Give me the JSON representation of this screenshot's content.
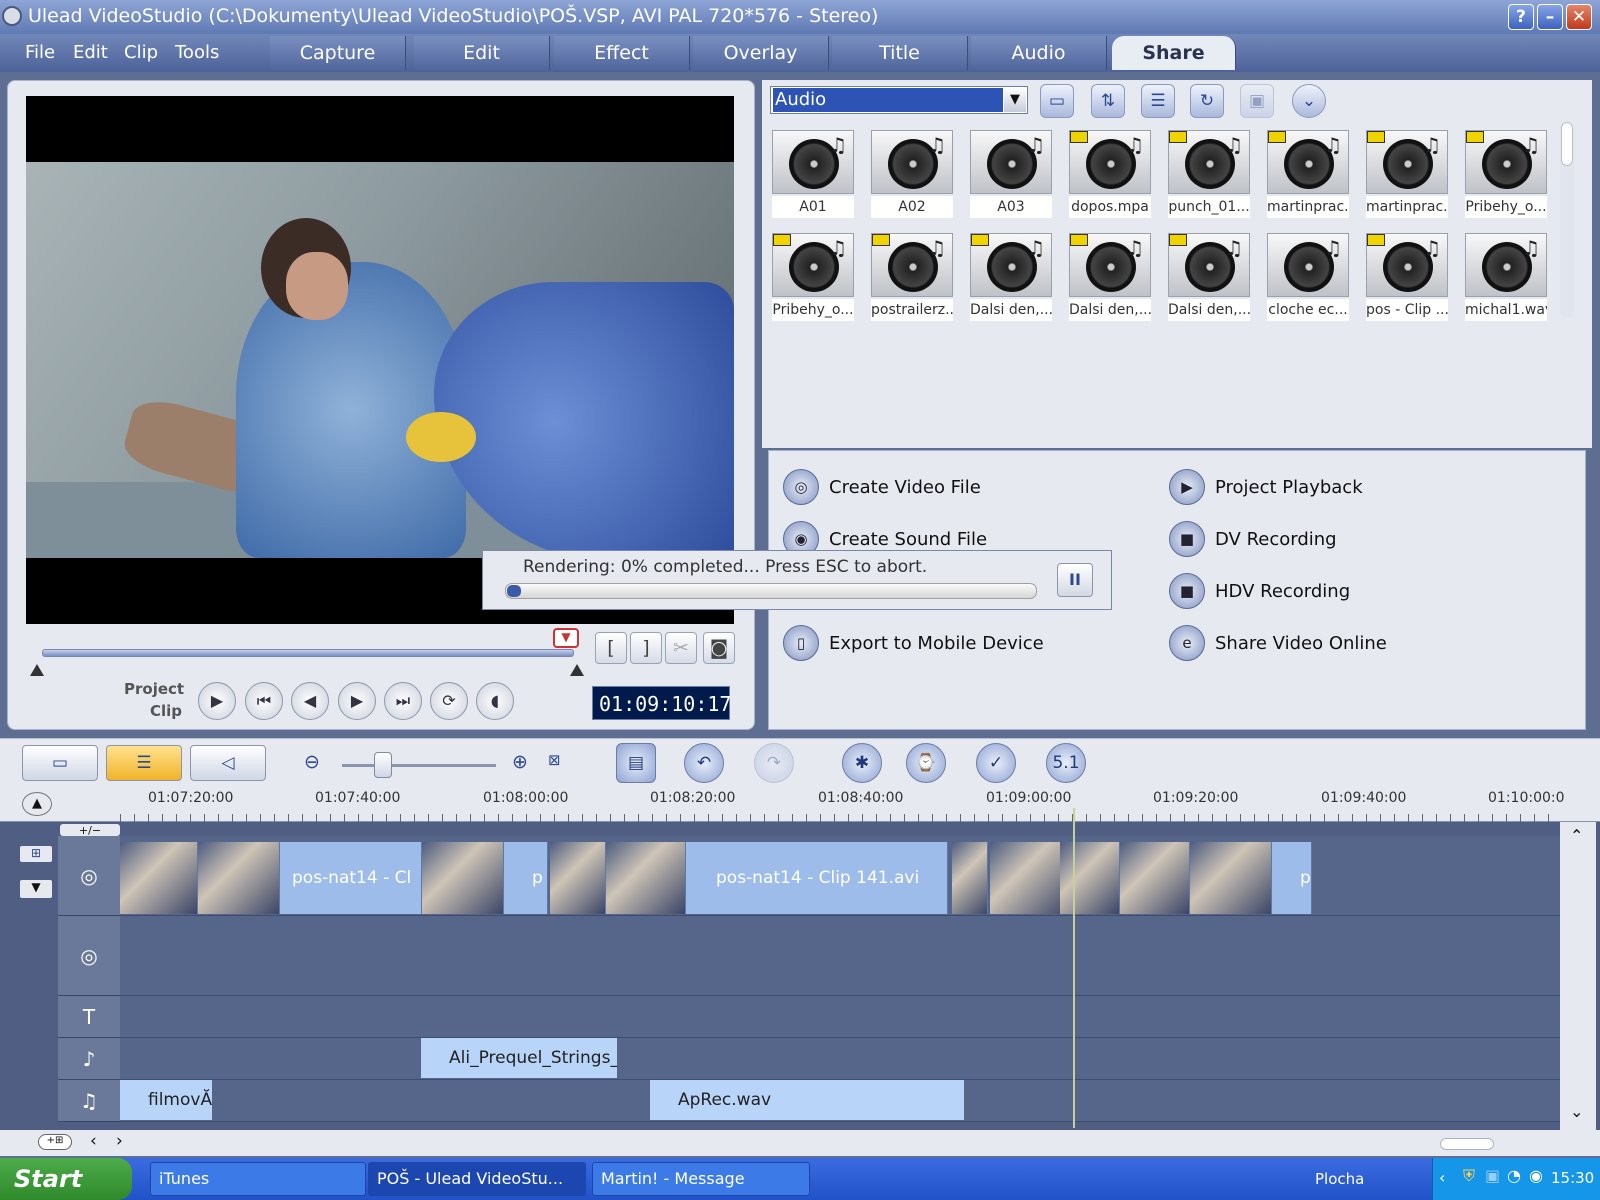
{
  "window": {
    "title": "Ulead VideoStudio (C:\\Dokumenty\\Ulead VideoStudio\\POŠ.VSP, AVI PAL 720*576 - Stereo)",
    "buttons": [
      "?",
      "–",
      "✕"
    ]
  },
  "menu": [
    "File",
    "Edit",
    "Clip",
    "Tools"
  ],
  "tabs": [
    {
      "label": "Capture"
    },
    {
      "label": "Edit"
    },
    {
      "label": "Effect"
    },
    {
      "label": "Overlay"
    },
    {
      "label": "Title"
    },
    {
      "label": "Audio"
    },
    {
      "label": "Share",
      "active": true
    }
  ],
  "player": {
    "mode_project": "Project",
    "mode_clip": "Clip",
    "timecode": "01:09:10:17",
    "trim_in": "[",
    "trim_out": "]"
  },
  "library": {
    "category": "Audio",
    "items": [
      "A01",
      "A02",
      "A03",
      "dopos.mpa",
      "punch_01...",
      "martinprac...",
      "martinprac...",
      "Pribehy_o...",
      "Pribehy_o...",
      "postrailerz...",
      "Dalsi den,...",
      "Dalsi den,...",
      "Dalsi den,...",
      "cloche ec...",
      "pos - Clip ...",
      "michal1.wav"
    ]
  },
  "share": {
    "items": [
      "Create Video File",
      "Create Sound File",
      "Export to Mobile Device",
      "Project Playback",
      "DV Recording",
      "HDV Recording",
      "Share Video Online"
    ]
  },
  "render": {
    "message": "Rendering:  0% completed... Press ESC to abort.",
    "progress": 0.02,
    "pause_label": "II"
  },
  "timeline": {
    "ticks": [
      "01:07:20:00",
      "01:07:40:00",
      "01:08:00:00",
      "01:08:20:00",
      "01:08:40:00",
      "01:09:00:00",
      "01:09:20:00",
      "01:09:40:00",
      "01:10:00:0"
    ],
    "add_label": "+/−",
    "clips": [
      "pos-nat14 - Cl",
      "p",
      "pos-nat14 - Clip 141.avi",
      "p"
    ],
    "voice_clip": "Ali_Prequel_Strings_",
    "music_clips": [
      "filmovĂ",
      "ApRec.wav"
    ],
    "track_icons": [
      "T",
      "♫"
    ]
  },
  "taskbar": {
    "start": "Start",
    "tasks": [
      "iTunes",
      "POŠ - Ulead VideoStu...",
      "Martin! - Message"
    ],
    "tray_label": "Plocha",
    "time": "15:30"
  }
}
